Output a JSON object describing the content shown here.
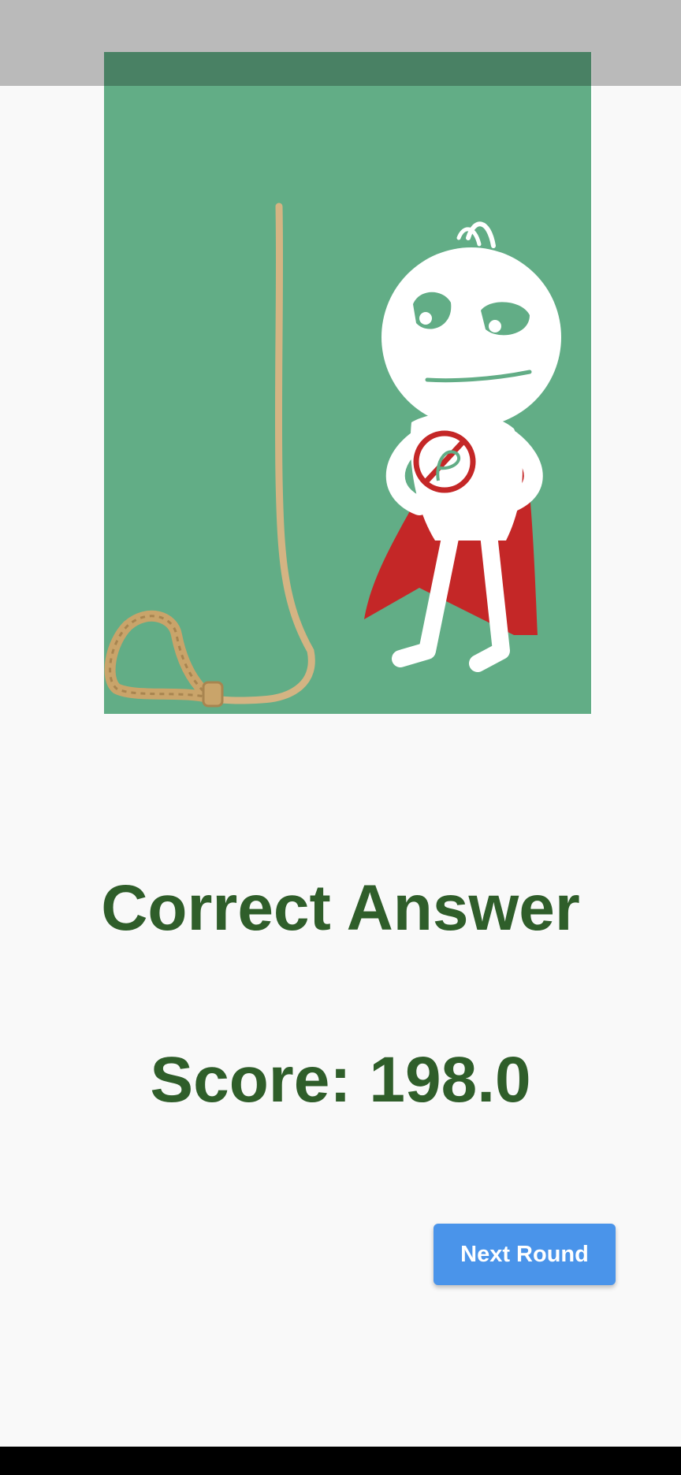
{
  "result": {
    "title": "Correct Answer",
    "score": "Score: 198.0"
  },
  "actions": {
    "next_round_label": "Next Round"
  },
  "illustration": {
    "subject": "superhero stick figure beside hangman noose",
    "background_color": "#62ad86",
    "cape_color": "#c42727",
    "rope_color": "#d4b483"
  },
  "colors": {
    "text_accent": "#2f5e2a",
    "button": "#4a94ea",
    "page_background": "#f9f9f9"
  }
}
